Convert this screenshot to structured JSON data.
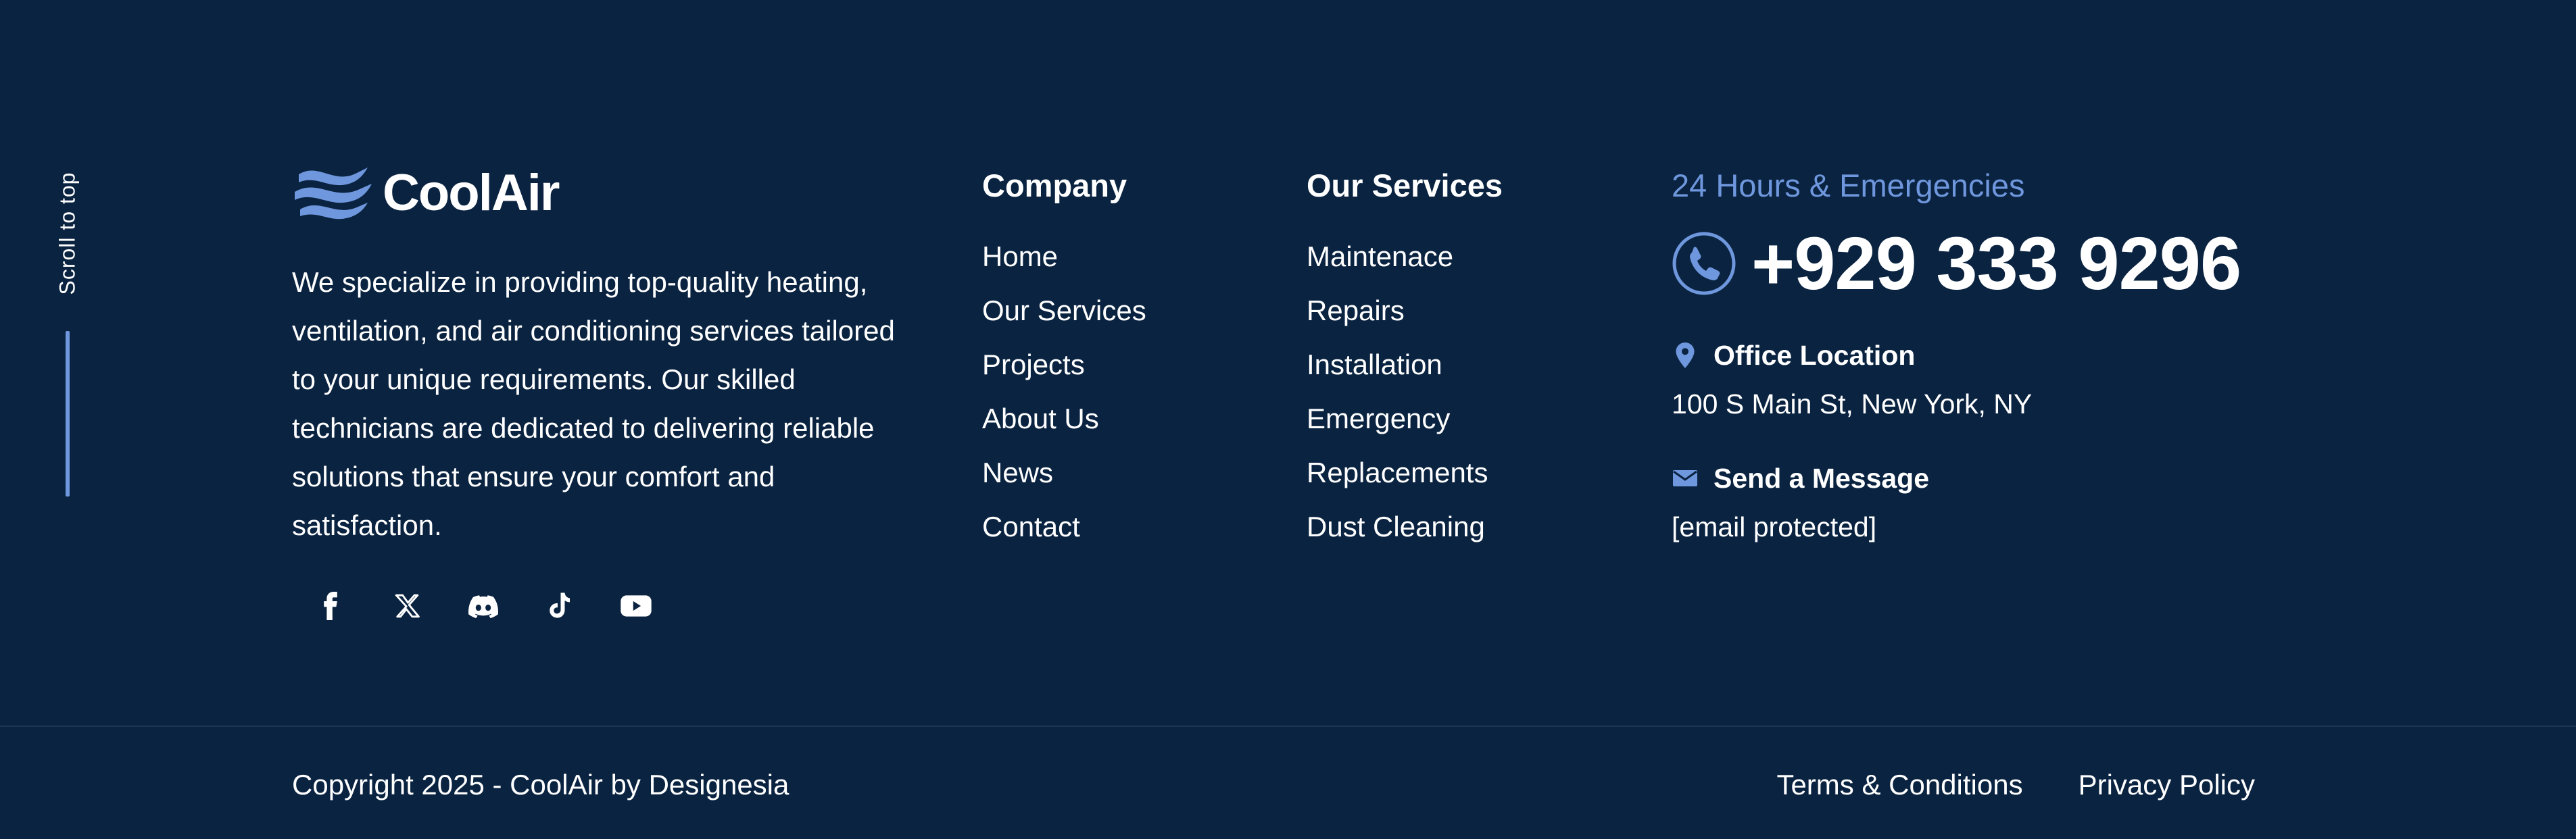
{
  "colors": {
    "background": "#0a2341",
    "accent": "#6f97dd",
    "text": "#ffffff",
    "divider": "#1c3656"
  },
  "scroll_top": {
    "label": "Scroll to top"
  },
  "brand": {
    "name": "CoolAir",
    "logo_icon": "wave-logo-icon",
    "description": "We specialize in providing top-quality heating, ventilation, and air conditioning services tailored to your unique requirements. Our skilled technicians are dedicated to delivering reliable solutions that ensure your comfort and satisfaction."
  },
  "socials": [
    {
      "name": "facebook",
      "icon": "facebook-icon"
    },
    {
      "name": "x",
      "icon": "x-twitter-icon"
    },
    {
      "name": "discord",
      "icon": "discord-icon"
    },
    {
      "name": "tiktok",
      "icon": "tiktok-icon"
    },
    {
      "name": "youtube",
      "icon": "youtube-icon"
    }
  ],
  "company": {
    "title": "Company",
    "items": [
      "Home",
      "Our Services",
      "Projects",
      "About Us",
      "News",
      "Contact"
    ]
  },
  "services": {
    "title": "Our Services",
    "items": [
      "Maintenace",
      "Repairs",
      "Installation",
      "Emergency",
      "Replacements",
      "Dust Cleaning"
    ]
  },
  "contact": {
    "emergency_label": "24 Hours & Emergencies",
    "phone_icon": "phone-icon",
    "phone": "+929 333 9296",
    "office_icon": "map-pin-icon",
    "office_label": "Office Location",
    "office_address": "100 S Main St, New York, NY",
    "message_icon": "envelope-icon",
    "message_label": "Send a Message",
    "email": "[email protected]"
  },
  "footer": {
    "copyright": "Copyright 2025 - CoolAir by Designesia",
    "links": [
      "Terms & Conditions",
      "Privacy Policy"
    ]
  }
}
